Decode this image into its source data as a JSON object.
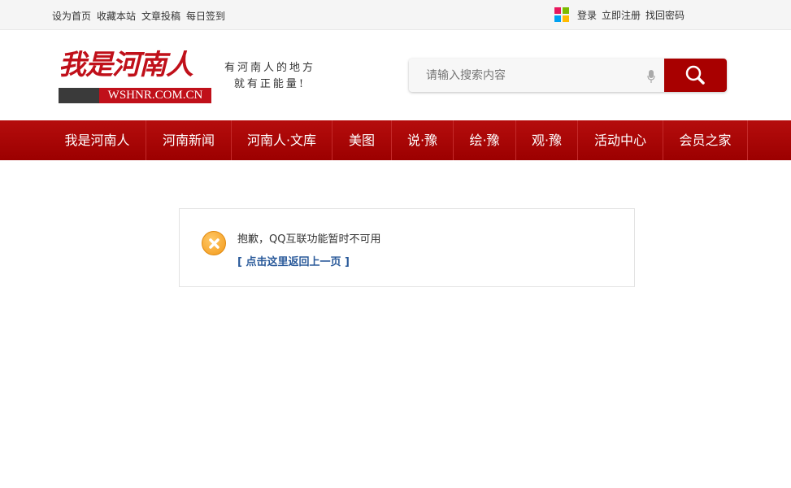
{
  "topbar": {
    "links": [
      "设为首页",
      "收藏本站",
      "文章投稿",
      "每日签到"
    ],
    "user_links": [
      "登录",
      "立即注册",
      "找回密码"
    ],
    "windows_colors": [
      "#e8175d",
      "#7cbb00",
      "#00a1f1",
      "#ffbb00"
    ]
  },
  "logo": {
    "text": "我是河南人",
    "domain": "WSHNR.COM.CN",
    "slogan_line1": "有河南人的地方",
    "slogan_line2": "就有正能量!"
  },
  "search": {
    "placeholder": "请输入搜索内容"
  },
  "nav": {
    "items": [
      "我是河南人",
      "河南新闻",
      "河南人·文库",
      "美图",
      "说·豫",
      "绘·豫",
      "观·豫",
      "活动中心",
      "会员之家"
    ]
  },
  "message": {
    "text": "抱歉，QQ互联功能暂时不可用",
    "back_link": "[ 点击这里返回上一页 ]"
  },
  "colors": {
    "brand_red": "#a80000",
    "link_blue": "#2a5a9a"
  }
}
